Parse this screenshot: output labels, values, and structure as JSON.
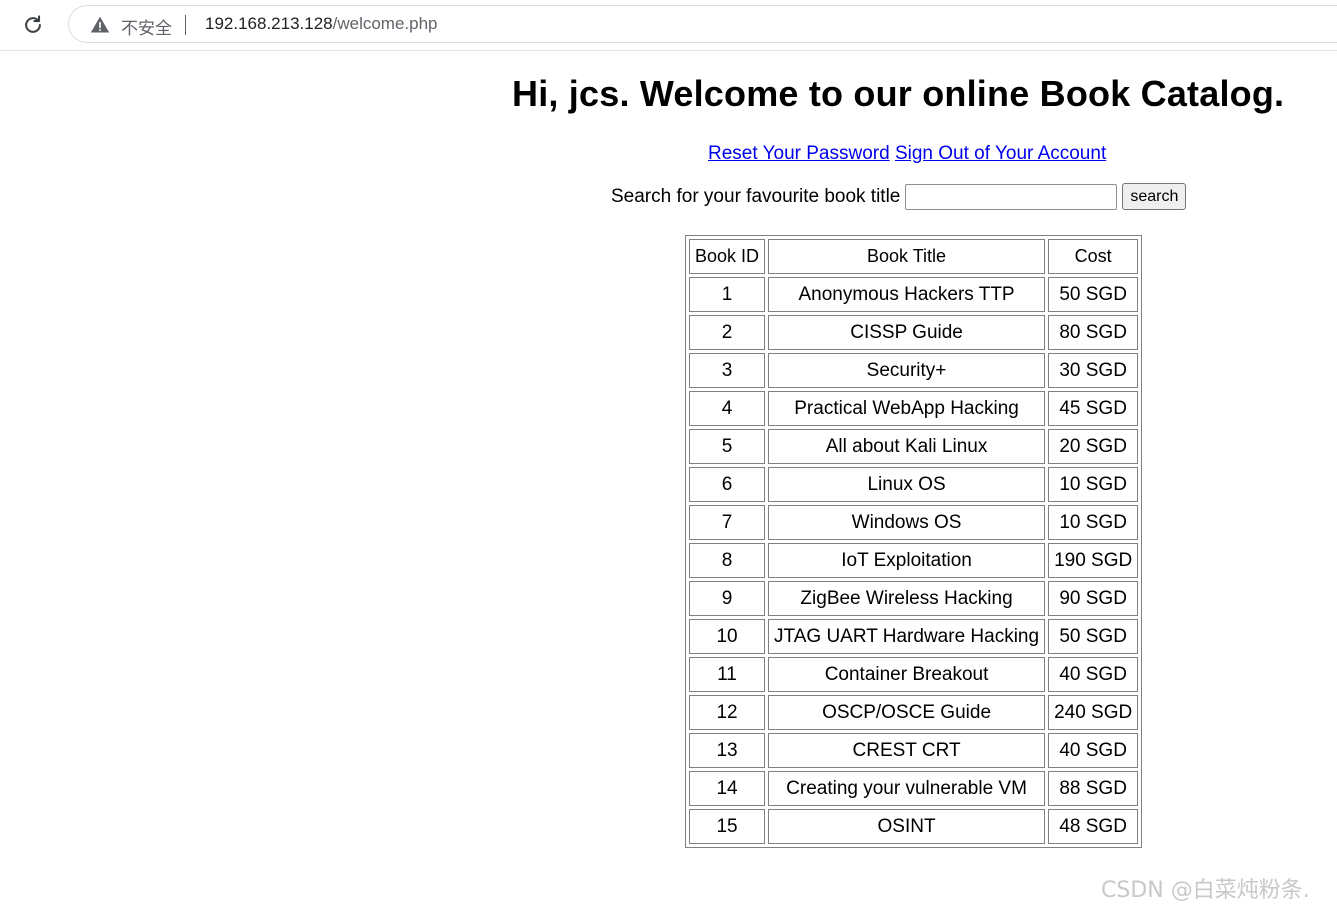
{
  "browser": {
    "security_label": "不安全",
    "url_host": "192.168.213.128",
    "url_path": "/welcome.php"
  },
  "page": {
    "title": "Hi, jcs. Welcome to our online Book Catalog.",
    "links": {
      "reset_password": "Reset Your Password",
      "sign_out": "Sign Out of Your Account"
    },
    "search": {
      "label": "Search for your favourite book title",
      "value": "",
      "button_label": "search"
    }
  },
  "table": {
    "headers": [
      "Book ID",
      "Book Title",
      "Cost"
    ],
    "rows": [
      [
        "1",
        "Anonymous Hackers TTP",
        "50 SGD"
      ],
      [
        "2",
        "CISSP Guide",
        "80 SGD"
      ],
      [
        "3",
        "Security+",
        "30 SGD"
      ],
      [
        "4",
        "Practical WebApp Hacking",
        "45 SGD"
      ],
      [
        "5",
        "All about Kali Linux",
        "20 SGD"
      ],
      [
        "6",
        "Linux OS",
        "10 SGD"
      ],
      [
        "7",
        "Windows OS",
        "10 SGD"
      ],
      [
        "8",
        "IoT Exploitation",
        "190 SGD"
      ],
      [
        "9",
        "ZigBee Wireless Hacking",
        "90 SGD"
      ],
      [
        "10",
        "JTAG UART Hardware Hacking",
        "50 SGD"
      ],
      [
        "11",
        "Container Breakout",
        "40 SGD"
      ],
      [
        "12",
        "OSCP/OSCE Guide",
        "240 SGD"
      ],
      [
        "13",
        "CREST CRT",
        "40 SGD"
      ],
      [
        "14",
        "Creating your vulnerable VM",
        "88 SGD"
      ],
      [
        "15",
        "OSINT",
        "48 SGD"
      ]
    ]
  },
  "watermark": "CSDN @白菜炖粉条.",
  "icons": {
    "reload": "reload-icon",
    "warning": "warning-triangle-icon"
  },
  "colors": {
    "link": "#0000ee",
    "table_border": "#808080"
  }
}
